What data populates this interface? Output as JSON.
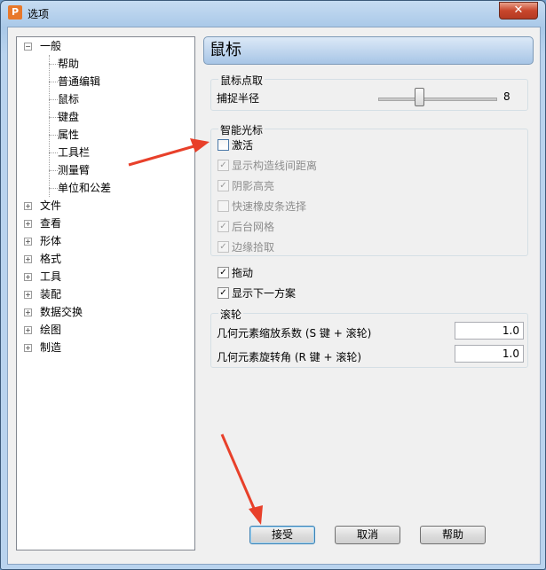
{
  "window": {
    "title": "选项",
    "close_glyph": "✕"
  },
  "tree": {
    "general": {
      "label": "一般",
      "children": [
        "帮助",
        "普通编辑",
        "鼠标",
        "键盘",
        "属性",
        "工具栏",
        "测量臂",
        "单位和公差"
      ]
    },
    "top_level": [
      "文件",
      "查看",
      "形体",
      "格式",
      "工具",
      "装配",
      "数据交换",
      "绘图",
      "制造"
    ],
    "selected": "鼠标"
  },
  "panel": {
    "title": "鼠标",
    "pick": {
      "group_title": "鼠标点取",
      "snap_radius_label": "捕捉半径",
      "snap_radius_value": "8"
    },
    "smart_cursor": {
      "group_title": "智能光标",
      "activate_label": "激活",
      "options": [
        "显示构造线间距离",
        "阴影高亮",
        "快速橡皮条选择",
        "后台网格",
        "边缘拾取"
      ]
    },
    "drag_label": "拖动",
    "show_next_label": "显示下一方案",
    "wheel": {
      "group_title": "滚轮",
      "zoom_factor_label": "几何元素缩放系数 (S 键 + 滚轮)",
      "zoom_factor_value": "1.0",
      "rotate_angle_label": "几何元素旋转角 (R 键 + 滚轮)",
      "rotate_angle_value": "1.0"
    }
  },
  "buttons": {
    "accept": "接受",
    "cancel": "取消",
    "help": "帮助"
  },
  "colors": {
    "arrow": "#e8402a",
    "title_accent": "#a7c5e6"
  }
}
